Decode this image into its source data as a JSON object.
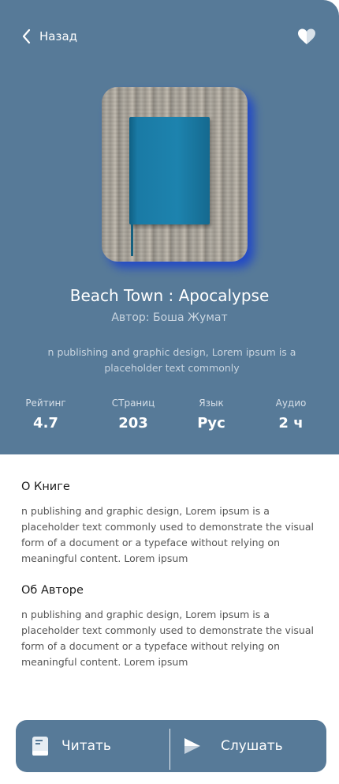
{
  "header": {
    "back_label": "Назад",
    "back_icon": "chevron-left-icon",
    "favorite_icon": "heart-icon"
  },
  "book": {
    "title": "Beach Town : Apocalypse",
    "author": "Автор: Боша Жумат",
    "short_description": "n publishing and graphic design, Lorem ipsum is a placeholder text commonly"
  },
  "stats": [
    {
      "label": "Рейтинг",
      "value": "4.7"
    },
    {
      "label": "СТраниц",
      "value": "203"
    },
    {
      "label": "Язык",
      "value": "Рус"
    },
    {
      "label": "Аудио",
      "value": "2 ч"
    }
  ],
  "about_book": {
    "title": "О Книге",
    "text": "n publishing and graphic design, Lorem ipsum is a placeholder text commonly used to demonstrate the visual form of a document or a typeface without relying on meaningful content. Lorem ipsum"
  },
  "about_author": {
    "title": "Об Авторе",
    "text": "n publishing and graphic design, Lorem ipsum is a placeholder text commonly used to demonstrate the visual form of a document or a typeface without relying on meaningful content. Lorem ipsum"
  },
  "actions": {
    "read_label": "Читать",
    "read_icon": "book-icon",
    "listen_label": "Слушать",
    "listen_icon": "play-icon"
  },
  "colors": {
    "primary": "#577a98",
    "cover_shadow": "#1f47c9",
    "background": "#ffffff"
  }
}
